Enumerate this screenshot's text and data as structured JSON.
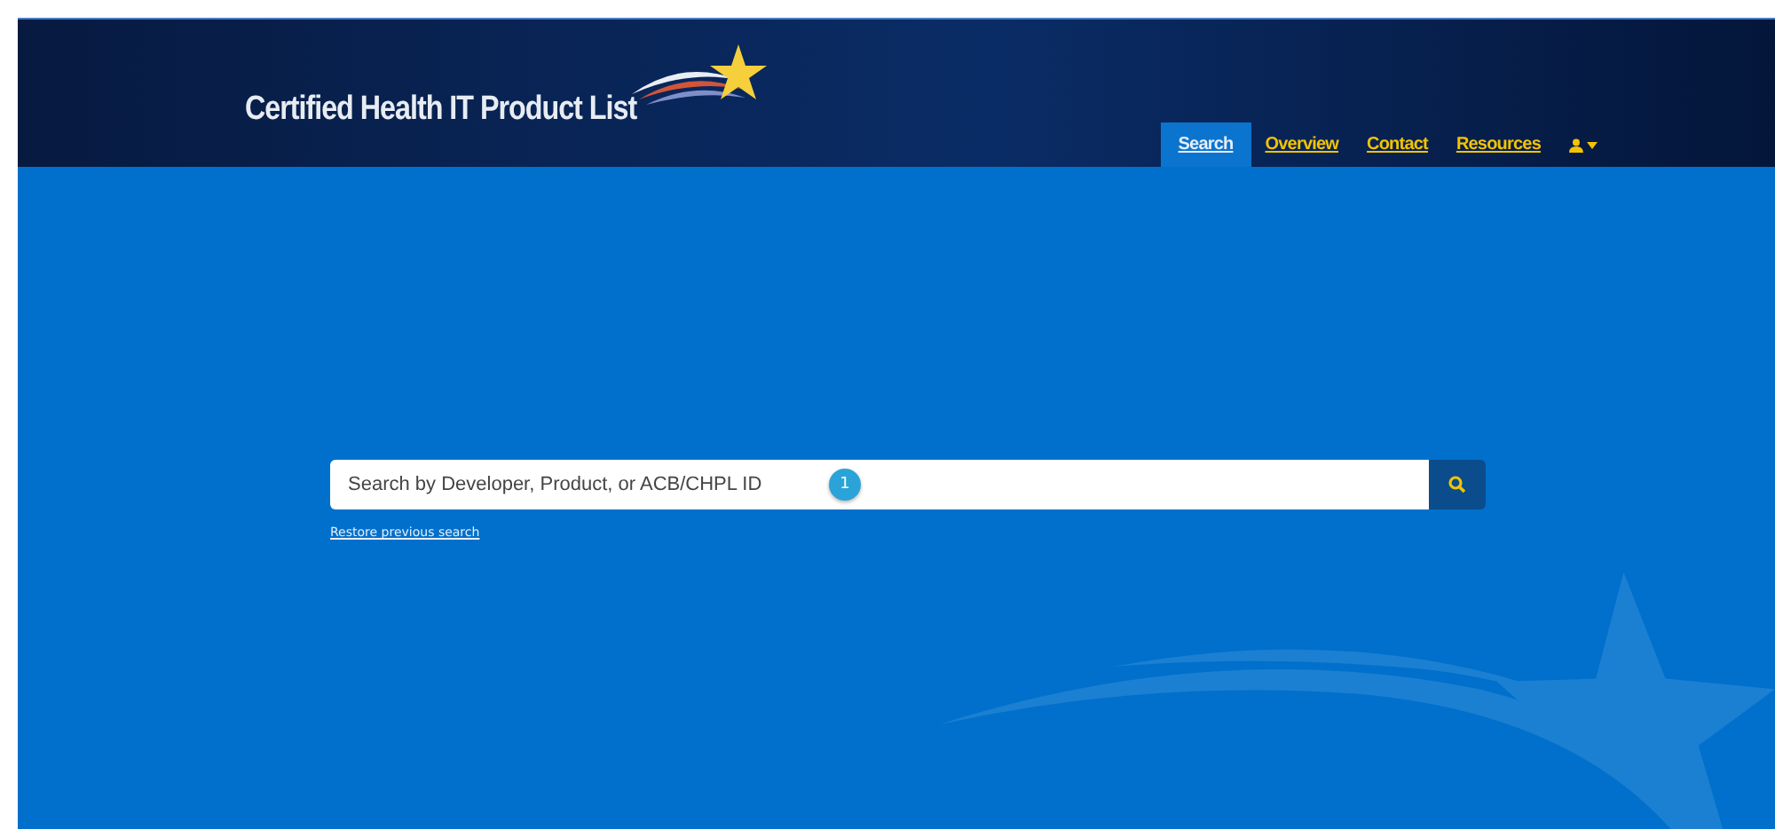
{
  "header": {
    "title": "Certified Health IT Product List"
  },
  "nav": [
    {
      "label": "Search",
      "selected": true
    },
    {
      "label": "Overview",
      "selected": false
    },
    {
      "label": "Contact",
      "selected": false
    },
    {
      "label": "Resources",
      "selected": false
    }
  ],
  "search": {
    "placeholder": "Search by Developer, Product, or ACB/CHPL ID",
    "step_badge": "1"
  },
  "restore_link": "Restore previous search"
}
